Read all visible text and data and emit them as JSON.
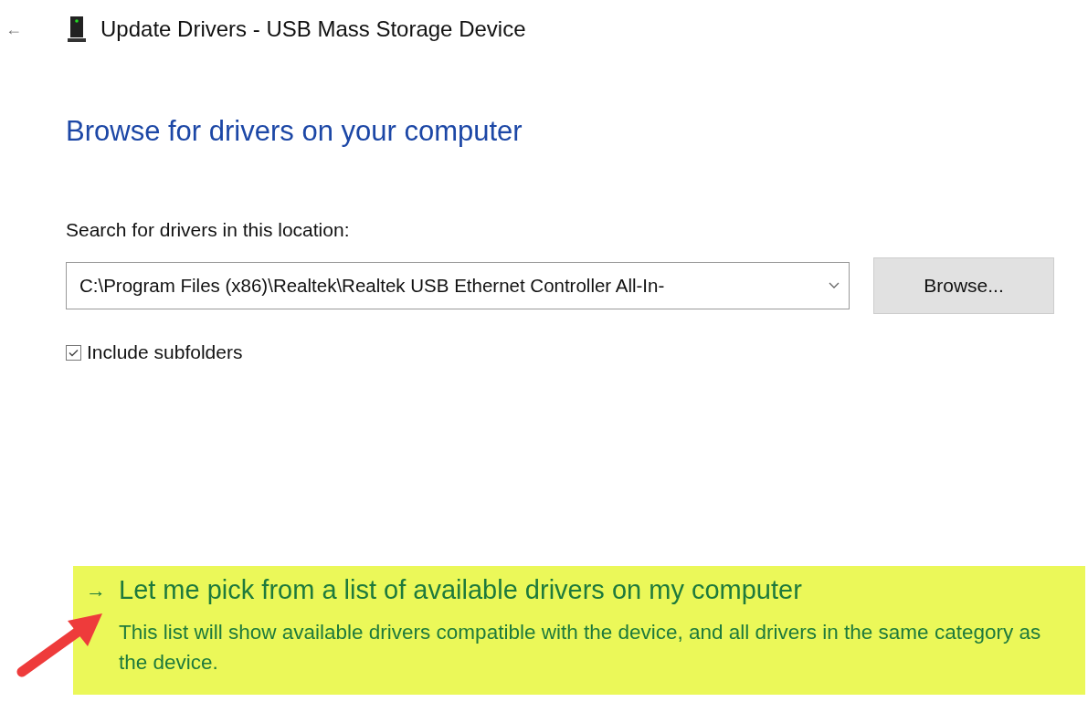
{
  "header": {
    "back": "←",
    "title": "Update Drivers - USB Mass Storage Device"
  },
  "heading": "Browse for drivers on your computer",
  "location": {
    "label": "Search for drivers in this location:",
    "value": "C:\\Program Files (x86)\\Realtek\\Realtek USB Ethernet Controller All-In-",
    "browse": "Browse..."
  },
  "include_subfolders": {
    "label": "Include subfolders",
    "checked": true
  },
  "pick_option": {
    "arrow": "→",
    "title": "Let me pick from a list of available drivers on my computer",
    "description": "This list will show available drivers compatible with the device, and all drivers in the same category as the device.",
    "highlighted": true
  }
}
